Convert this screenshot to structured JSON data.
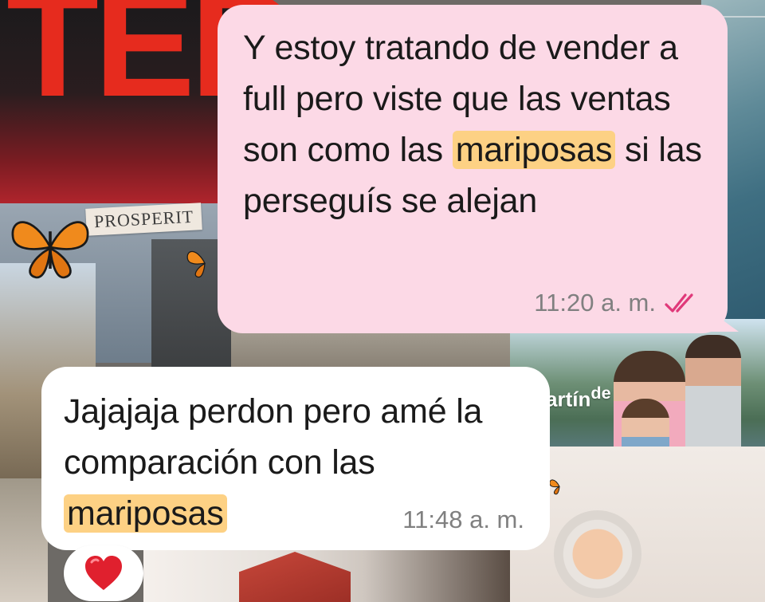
{
  "messages": [
    {
      "direction": "outgoing",
      "text_parts": [
        "Y estoy tratando de vender a full pero viste que las ventas son como las ",
        "mariposas",
        " si las perseguís se alejan"
      ],
      "time": "11:20 a. m.",
      "status_icon": "double-check-read-icon",
      "bubble_color": "#fcd9e6",
      "highlight_color": "#fdd184",
      "check_color": "#e0397a"
    },
    {
      "direction": "incoming",
      "text_parts": [
        "Jajajaja perdon pero amé la comparación con las ",
        "mariposas"
      ],
      "time": "11:48 a. m.",
      "bubble_color": "#ffffff",
      "highlight_color": "#fdd184"
    }
  ],
  "reaction": {
    "emoji": "heart",
    "color": "#e0202e"
  },
  "wallpaper": {
    "ted_text": "TED",
    "prosperity_text": "PROSPERIT",
    "martin_text": "artín",
    "martin_super": "de"
  }
}
